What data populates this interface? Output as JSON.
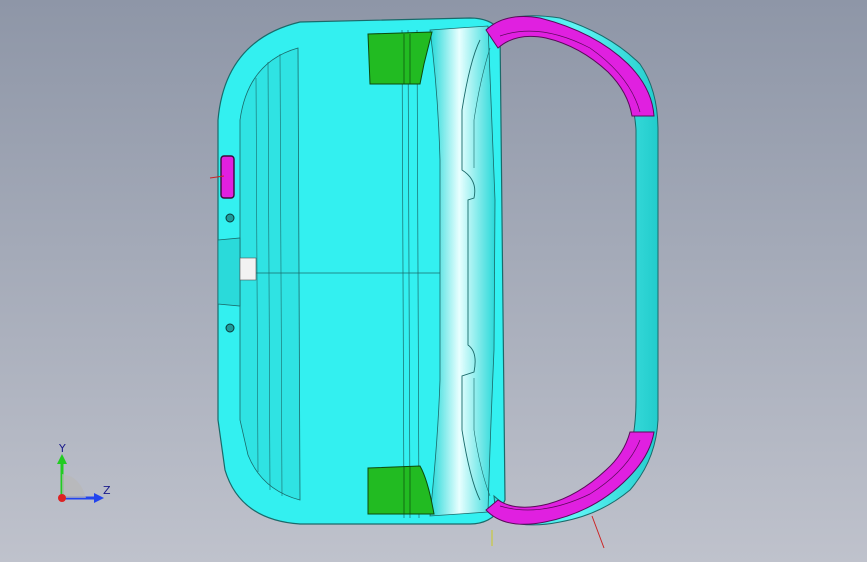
{
  "viewport": {
    "background_top": "#8e96a7",
    "background_bottom": "#bfc2cc"
  },
  "model": {
    "body_color": "#33f0f0",
    "edge_color": "#1a5a5a",
    "accent_color": "#e020e0",
    "block_color": "#22bb22"
  },
  "triad": {
    "y_label": "Y",
    "z_label": "Z",
    "y_color": "#22cc22",
    "z_color": "#2244ee",
    "x_color": "#dd2222"
  }
}
